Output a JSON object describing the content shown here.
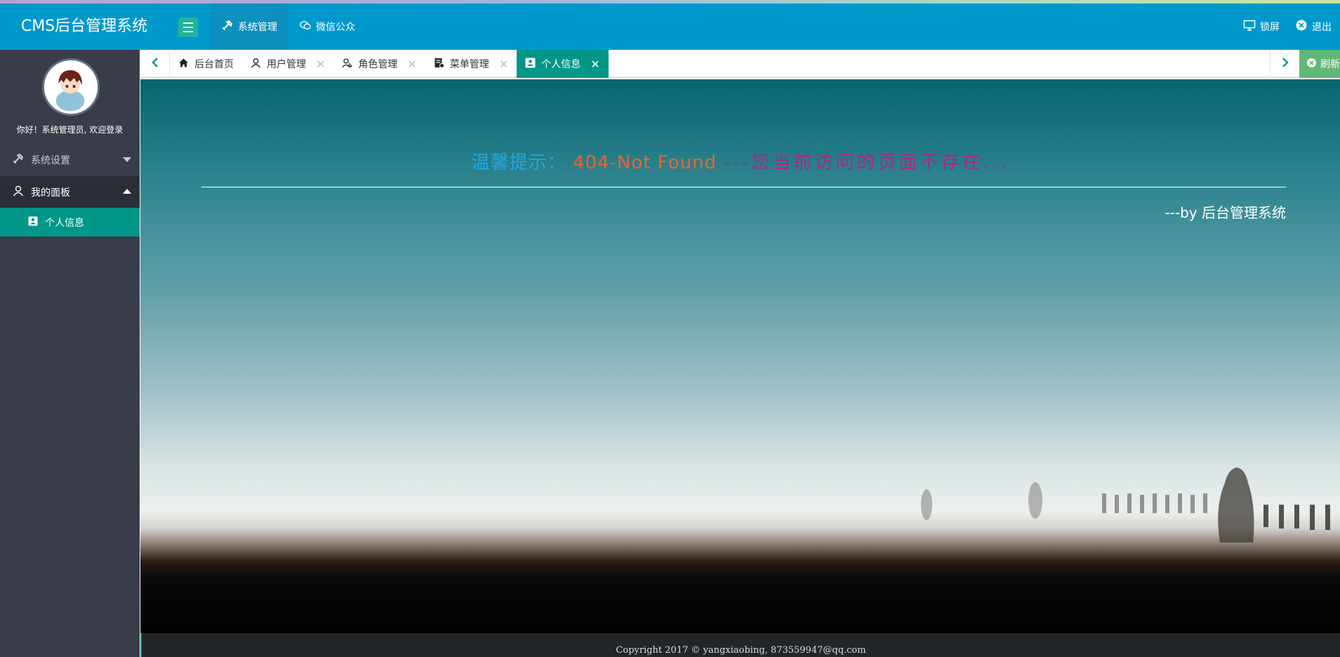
{
  "app": {
    "title": "CMS后台管理系统"
  },
  "topnav": [
    {
      "label": "系统管理",
      "icon": "tools-icon",
      "active": true
    },
    {
      "label": "微信公众",
      "icon": "wechat-icon",
      "active": false
    }
  ],
  "topright": {
    "lock_label": "锁屏",
    "logout_label": "退出"
  },
  "sidebar": {
    "welcome": "你好！系统管理员, 欢迎登录",
    "groups": [
      {
        "label": "系统设置",
        "icon": "tools-icon",
        "expanded": false
      },
      {
        "label": "我的面板",
        "icon": "user-icon",
        "expanded": true,
        "items": [
          {
            "label": "个人信息",
            "icon": "id-card-icon",
            "active": true
          }
        ]
      }
    ]
  },
  "tabs": [
    {
      "label": "后台首页",
      "icon": "home-icon",
      "closable": false,
      "active": false
    },
    {
      "label": "用户管理",
      "icon": "user-icon",
      "closable": true,
      "active": false
    },
    {
      "label": "角色管理",
      "icon": "role-icon",
      "closable": true,
      "active": false
    },
    {
      "label": "菜单管理",
      "icon": "menu-doc-icon",
      "closable": true,
      "active": false
    },
    {
      "label": "个人信息",
      "icon": "id-card-icon",
      "closable": true,
      "active": true
    }
  ],
  "tabbar": {
    "refresh_label": "刷新"
  },
  "content": {
    "tip": "温馨提示：",
    "error_code": "404-Not Found",
    "message": "---您当前访问的页面不存在...",
    "signature": "---by 后台管理系统"
  },
  "footer": {
    "copyright": "Copyright 2017 © yangxiaobing, 873559947@qq.com"
  },
  "colors": {
    "header": "#0099cc",
    "sidebar": "#393d49",
    "accent": "#009688",
    "refresh": "#5fb878",
    "tip": "#22a7e0",
    "error": "#f0622a",
    "message": "#b0287a"
  }
}
